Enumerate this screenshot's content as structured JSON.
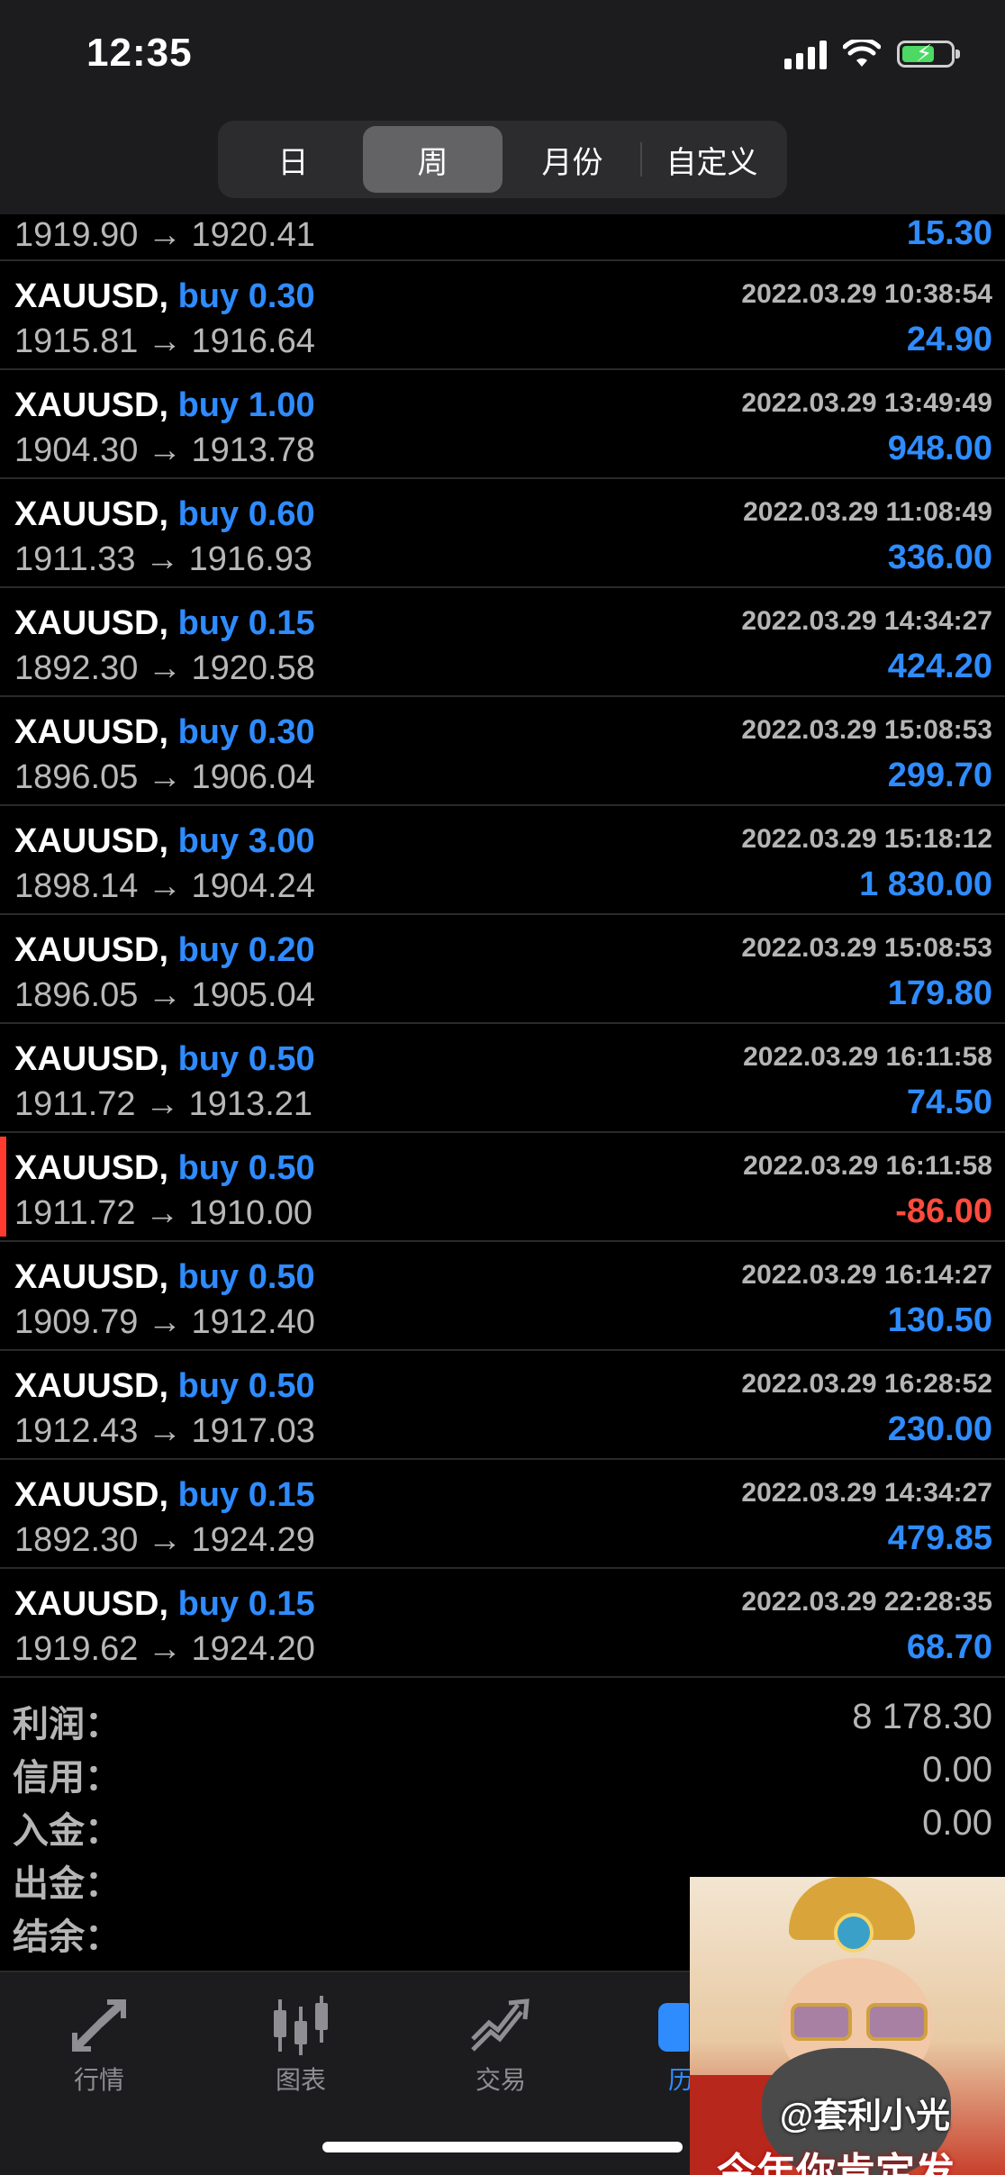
{
  "status_bar": {
    "time": "12:35"
  },
  "period_tabs": [
    {
      "label": "日",
      "active": false
    },
    {
      "label": "周",
      "active": true
    },
    {
      "label": "月份",
      "active": false
    },
    {
      "label": "自定义",
      "active": false
    }
  ],
  "partial_row": {
    "prices": "1919.90 → 1920.41",
    "profit": "15.30"
  },
  "deals": [
    {
      "symbol": "XAUUSD,",
      "side": "buy 0.30",
      "time": "2022.03.29 10:38:54",
      "prices": "1915.81 → 1916.64",
      "profit": "24.90",
      "negative": false
    },
    {
      "symbol": "XAUUSD,",
      "side": "buy 1.00",
      "time": "2022.03.29 13:49:49",
      "prices": "1904.30 → 1913.78",
      "profit": "948.00",
      "negative": false
    },
    {
      "symbol": "XAUUSD,",
      "side": "buy 0.60",
      "time": "2022.03.29 11:08:49",
      "prices": "1911.33 → 1916.93",
      "profit": "336.00",
      "negative": false
    },
    {
      "symbol": "XAUUSD,",
      "side": "buy 0.15",
      "time": "2022.03.29 14:34:27",
      "prices": "1892.30 → 1920.58",
      "profit": "424.20",
      "negative": false
    },
    {
      "symbol": "XAUUSD,",
      "side": "buy 0.30",
      "time": "2022.03.29 15:08:53",
      "prices": "1896.05 → 1906.04",
      "profit": "299.70",
      "negative": false
    },
    {
      "symbol": "XAUUSD,",
      "side": "buy 3.00",
      "time": "2022.03.29 15:18:12",
      "prices": "1898.14 → 1904.24",
      "profit": "1 830.00",
      "negative": false
    },
    {
      "symbol": "XAUUSD,",
      "side": "buy 0.20",
      "time": "2022.03.29 15:08:53",
      "prices": "1896.05 → 1905.04",
      "profit": "179.80",
      "negative": false
    },
    {
      "symbol": "XAUUSD,",
      "side": "buy 0.50",
      "time": "2022.03.29 16:11:58",
      "prices": "1911.72 → 1913.21",
      "profit": "74.50",
      "negative": false
    },
    {
      "symbol": "XAUUSD,",
      "side": "buy 0.50",
      "time": "2022.03.29 16:11:58",
      "prices": "1911.72 → 1910.00",
      "profit": "-86.00",
      "negative": true
    },
    {
      "symbol": "XAUUSD,",
      "side": "buy 0.50",
      "time": "2022.03.29 16:14:27",
      "prices": "1909.79 → 1912.40",
      "profit": "130.50",
      "negative": false
    },
    {
      "symbol": "XAUUSD,",
      "side": "buy 0.50",
      "time": "2022.03.29 16:28:52",
      "prices": "1912.43 → 1917.03",
      "profit": "230.00",
      "negative": false
    },
    {
      "symbol": "XAUUSD,",
      "side": "buy 0.15",
      "time": "2022.03.29 14:34:27",
      "prices": "1892.30 → 1924.29",
      "profit": "479.85",
      "negative": false
    },
    {
      "symbol": "XAUUSD,",
      "side": "buy 0.15",
      "time": "2022.03.29 22:28:35",
      "prices": "1919.62 → 1924.20",
      "profit": "68.70",
      "negative": false
    }
  ],
  "summary": [
    {
      "label": "利润：",
      "value": "8 178.30"
    },
    {
      "label": "信用：",
      "value": "0.00"
    },
    {
      "label": "入金：",
      "value": "0.00"
    },
    {
      "label": "出金：",
      "value": ""
    },
    {
      "label": "结余：",
      "value": ""
    }
  ],
  "tabbar": [
    {
      "label": "行情",
      "icon": "quotes-arrows-icon"
    },
    {
      "label": "图表",
      "icon": "candlestick-chart-icon"
    },
    {
      "label": "交易",
      "icon": "trade-trend-icon"
    },
    {
      "label": "历",
      "icon": "history-icon"
    }
  ],
  "overlay": {
    "watermark": "@套利小光",
    "banner": "今年你肯定发"
  },
  "colors": {
    "buy_blue": "#2f8cff",
    "loss_red": "#ff4b3e",
    "background": "#000000"
  }
}
